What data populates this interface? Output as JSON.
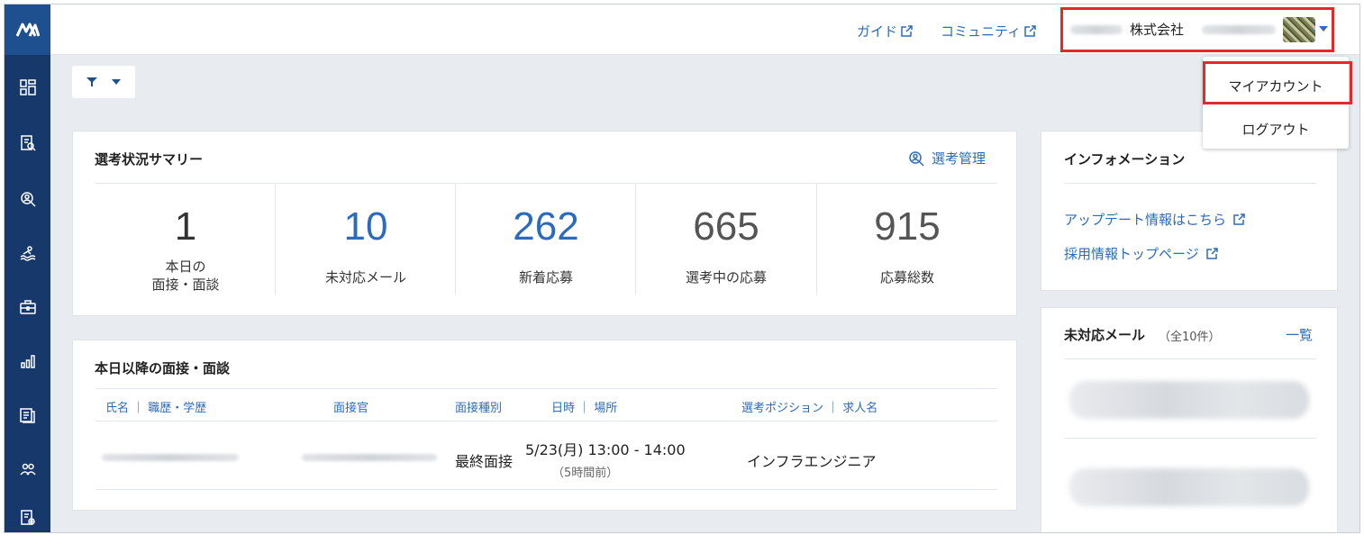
{
  "header": {
    "guide_link": "ガイド",
    "community_link": "コミュニティ",
    "company_name": "株式会社"
  },
  "dropdown": {
    "my_account": "マイアカウント",
    "logout": "ログアウト"
  },
  "summary": {
    "title": "選考状況サマリー",
    "manage_link": "選考管理",
    "stats": [
      {
        "value": "1",
        "label": "本日の\n面接・面談"
      },
      {
        "value": "10",
        "label": "未対応メール"
      },
      {
        "value": "262",
        "label": "新着応募"
      },
      {
        "value": "665",
        "label": "選考中の応募"
      },
      {
        "value": "915",
        "label": "応募総数"
      }
    ]
  },
  "interviews": {
    "title": "本日以降の面接・面談",
    "columns": {
      "name": "氏名 ｜ 職歴・学歴",
      "interviewer": "面接官",
      "type": "面接種別",
      "datetime": "日時 ｜ 場所",
      "position": "選考ポジション ｜ 求人名"
    },
    "rows": [
      {
        "type": "最終面接",
        "datetime": "5/23(月) 13:00 - 14:00",
        "relative": "（5時間前）",
        "position": "インフラエンジニア"
      }
    ]
  },
  "info": {
    "title": "インフォメーション",
    "links": [
      "アップデート情報はこちら",
      "採用情報トップページ"
    ]
  },
  "unread_mail": {
    "title": "未対応メール",
    "count": "（全10件）",
    "list_link": "一覧"
  },
  "colors": {
    "accent": "#2a6bbf",
    "sidebar": "#16386b",
    "highlight": "#e12b2b"
  }
}
